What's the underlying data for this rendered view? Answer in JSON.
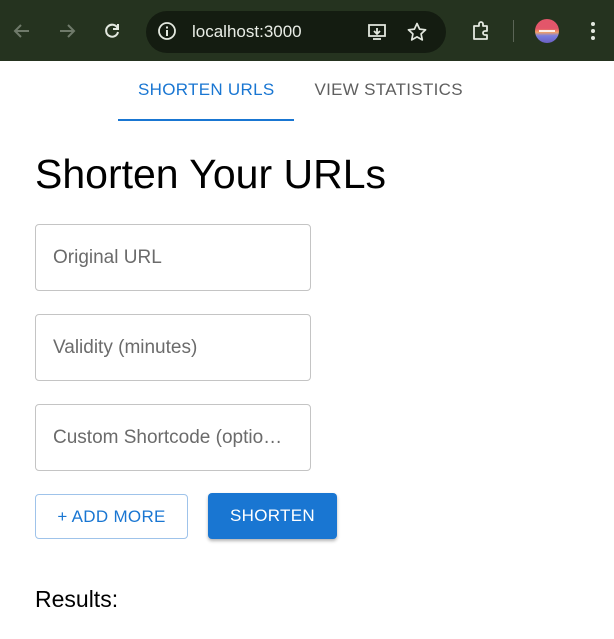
{
  "browser": {
    "url": "localhost:3000",
    "icons": [
      "back-icon",
      "forward-icon",
      "reload-icon",
      "site-info-icon",
      "install-app-icon",
      "bookmark-star-icon",
      "extensions-icon",
      "profile-avatar",
      "menu-dots-icon"
    ]
  },
  "tabs": [
    {
      "label": "SHORTEN URLS",
      "active": true
    },
    {
      "label": "VIEW STATISTICS",
      "active": false
    }
  ],
  "main": {
    "title": "Shorten Your URLs",
    "fields": [
      {
        "placeholder": "Original URL",
        "value": ""
      },
      {
        "placeholder": "Validity (minutes)",
        "value": ""
      },
      {
        "placeholder": "Custom Shortcode (optio…",
        "value": ""
      }
    ],
    "add_more_label": "+ ADD MORE",
    "shorten_label": "SHORTEN",
    "results_heading": "Results:"
  },
  "colors": {
    "accent": "#1976d2",
    "chrome_bg": "#25331f",
    "omnibox_bg": "#141c11"
  }
}
